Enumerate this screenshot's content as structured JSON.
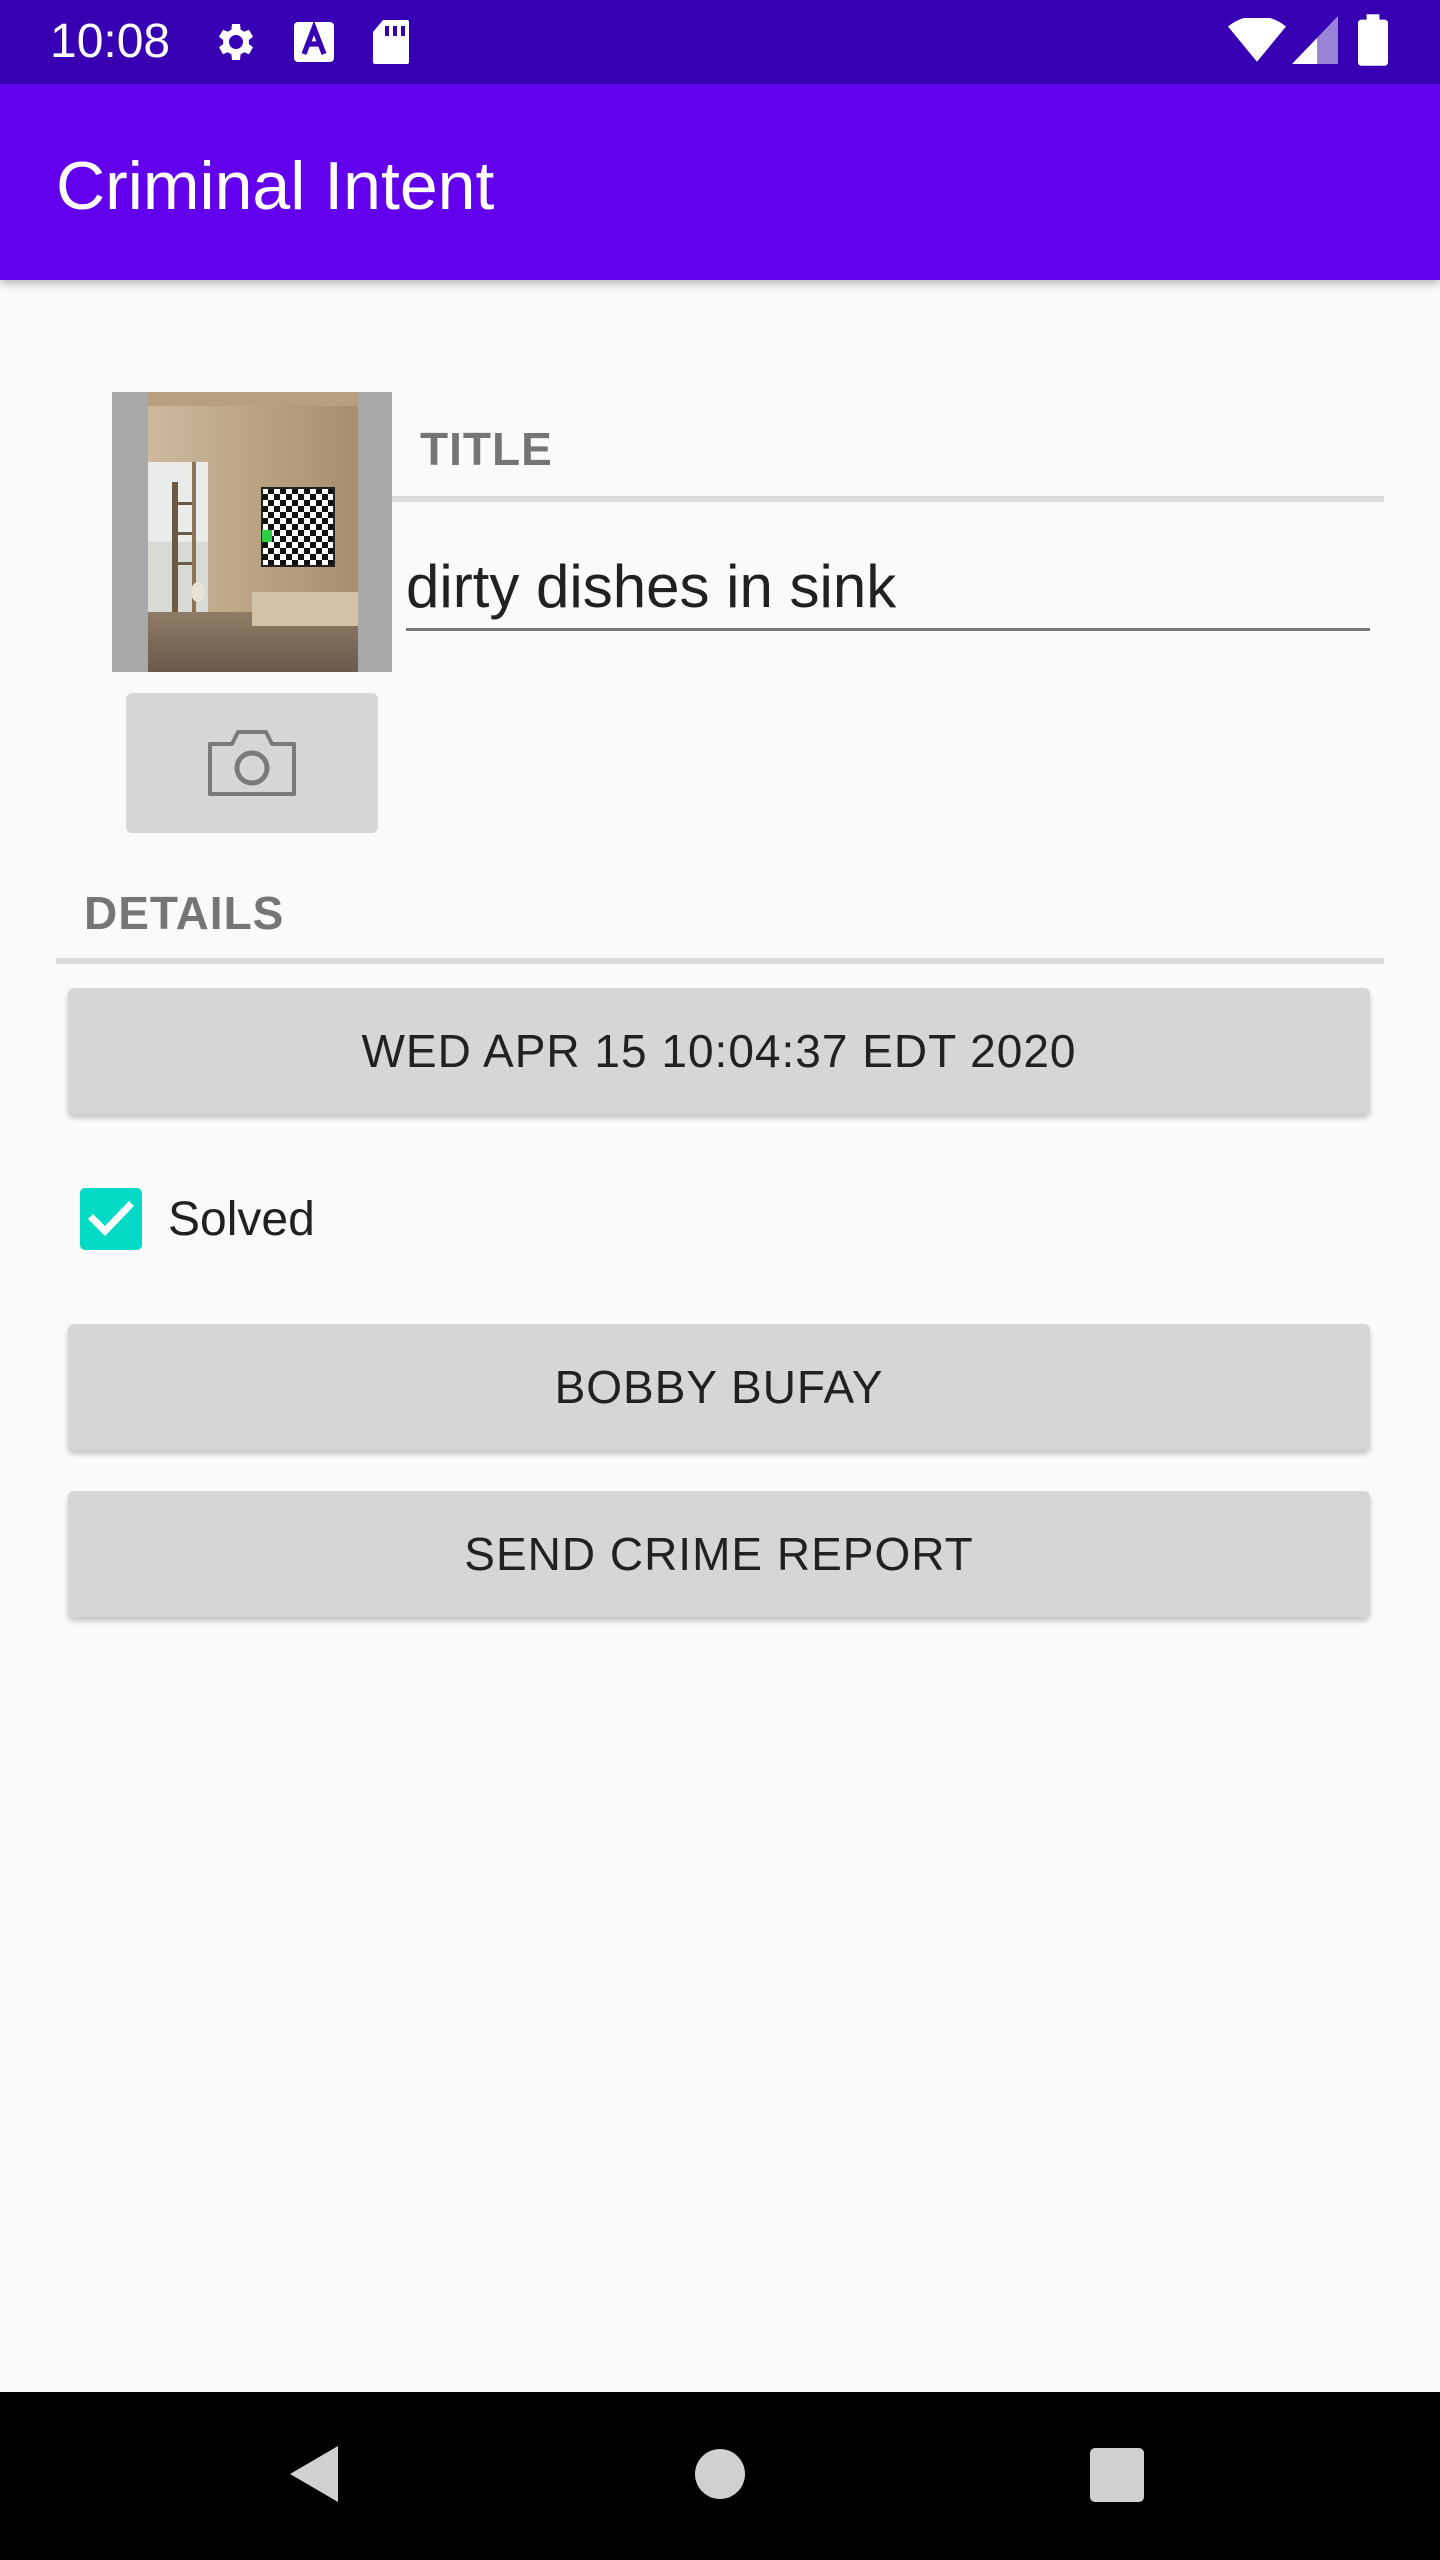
{
  "status_bar": {
    "time": "10:08",
    "icons": [
      "settings-icon",
      "text-a-icon",
      "sd-card-icon",
      "wifi-icon",
      "signal-icon",
      "battery-icon"
    ]
  },
  "app_bar": {
    "title": "Criminal Intent"
  },
  "photo": {
    "alt": "crime scene photo"
  },
  "camera_button": {
    "icon": "camera-icon"
  },
  "title_section": {
    "label": "TITLE",
    "value": "dirty dishes in sink"
  },
  "details_section": {
    "label": "DETAILS",
    "date_button": "WED APR 15 10:04:37 EDT 2020",
    "solved_label": "Solved",
    "solved_checked": true,
    "suspect_button": "BOBBY BUFAY",
    "report_button": "SEND CRIME REPORT"
  },
  "colors": {
    "status_bar": "#3700b3",
    "app_bar": "#6200ee",
    "checkbox": "#03dac5",
    "button": "#d6d6d6"
  },
  "nav_bar": {
    "icons": [
      "back-icon",
      "home-icon",
      "recents-icon"
    ]
  }
}
